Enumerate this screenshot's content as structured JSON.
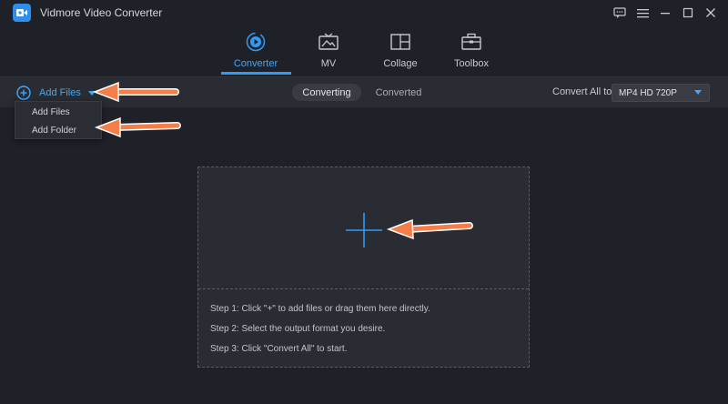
{
  "app": {
    "title": "Vidmore Video Converter",
    "logo_icon": "video-converter-logo",
    "accent_color": "#2f9bf5"
  },
  "window_controls": [
    {
      "name": "feedback-icon"
    },
    {
      "name": "menu-icon"
    },
    {
      "name": "minimize-icon"
    },
    {
      "name": "maximize-icon"
    },
    {
      "name": "close-icon"
    }
  ],
  "nav": {
    "tabs": [
      {
        "label": "Converter",
        "icon": "converter-icon",
        "active": true
      },
      {
        "label": "MV",
        "icon": "mv-icon",
        "active": false
      },
      {
        "label": "Collage",
        "icon": "collage-icon",
        "active": false
      },
      {
        "label": "Toolbox",
        "icon": "toolbox-icon",
        "active": false
      }
    ]
  },
  "toolbar": {
    "add_files_label": "Add Files",
    "segments": [
      "Converting",
      "Converted"
    ],
    "convert_all_label": "Convert All to:",
    "format_value": "MP4 HD 720P"
  },
  "dropdown": {
    "items": [
      "Add Files",
      "Add Folder"
    ]
  },
  "dropzone": {
    "steps": [
      "Step 1: Click \"+\" to add files or drag them here directly.",
      "Step 2: Select the output format you desire.",
      "Step 3: Click \"Convert All\" to start."
    ]
  },
  "annotation_color": "#f47e4a"
}
